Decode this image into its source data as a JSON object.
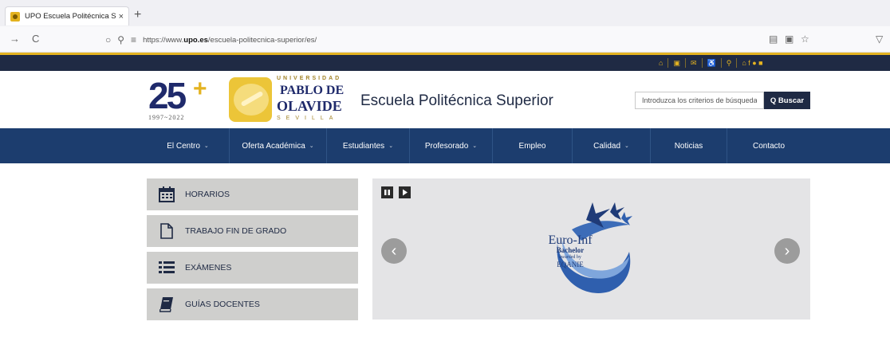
{
  "browser": {
    "tab_title": "UPO Escuela Politécnica Super",
    "tab_close": "×",
    "new_tab": "+",
    "back": "→",
    "reload": "C",
    "url_prefix": "https://www.",
    "url_domain": "upo.es",
    "url_path": "/escuela-politecnica-superior/es/"
  },
  "topbar": {
    "icons": [
      "home-icon",
      "sitemap-icon",
      "mail-icon",
      "accessibility-icon",
      "search-icon",
      "social-icons"
    ]
  },
  "header": {
    "logo25_num": "25",
    "logo25_plus": "+",
    "logo25_years": "1997~2022",
    "upo_univ": "UNIVERSIDAD",
    "upo_pablo": "PABLO DE",
    "upo_olavide": "OLAVIDE",
    "upo_sevilla": "SEVILLA",
    "title": "Escuela Politécnica Superior",
    "search_placeholder": "Introduzca los criterios de búsqueda",
    "search_button": "Q Buscar"
  },
  "menu": {
    "items": [
      {
        "label": "El Centro",
        "caret": "⌄"
      },
      {
        "label": "Oferta Académica",
        "caret": "⌄"
      },
      {
        "label": "Estudiantes",
        "caret": "⌄"
      },
      {
        "label": "Profesorado",
        "caret": "⌄"
      },
      {
        "label": "Empleo",
        "caret": ""
      },
      {
        "label": "Calidad",
        "caret": "⌄"
      },
      {
        "label": "Noticias",
        "caret": ""
      },
      {
        "label": "Contacto",
        "caret": ""
      }
    ]
  },
  "quicklinks": [
    {
      "label": "HORARIOS",
      "icon": "calendar-icon"
    },
    {
      "label": "TRABAJO FIN DE GRADO",
      "icon": "document-icon"
    },
    {
      "label": "EXÁMENES",
      "icon": "list-icon"
    },
    {
      "label": "GUÍAS DOCENTES",
      "icon": "book-icon"
    }
  ],
  "slider": {
    "prev": "‹",
    "next": "›",
    "badge_name": "Euro-Inf",
    "badge_bachelor": "Bachelor",
    "badge_awarded": "awarded by",
    "badge_org": "EQANIE"
  },
  "colors": {
    "navy": "#1f2a44",
    "menu_blue": "#1c3d6e",
    "gold": "#e4b321",
    "quicklink_bg": "#cfcfcd"
  }
}
